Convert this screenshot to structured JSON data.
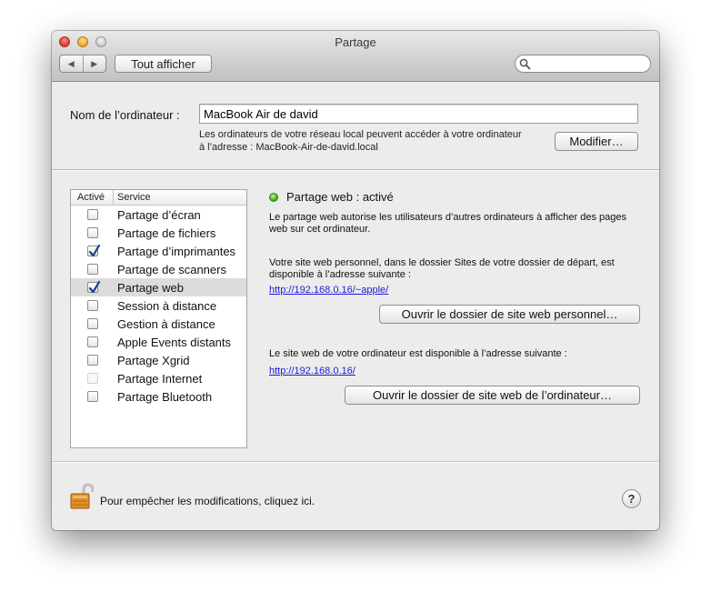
{
  "window": {
    "title": "Partage"
  },
  "toolbar": {
    "back_glyph": "◀",
    "forward_glyph": "▶",
    "show_all_label": "Tout afficher",
    "search_icon": "magnifier-icon",
    "search_value": ""
  },
  "computer": {
    "label": "Nom de l’ordinateur :",
    "name_value": "MacBook Air de david",
    "address_note": "Les ordinateurs de votre réseau local peuvent accéder à votre ordinateur à l’adresse : MacBook-Air-de-david.local",
    "modify_label": "Modifier…"
  },
  "services": {
    "header_active": "Activé",
    "header_service": "Service",
    "items": [
      {
        "label": "Partage d’écran",
        "checked": false,
        "enabled": true,
        "selected": false
      },
      {
        "label": "Partage de fichiers",
        "checked": false,
        "enabled": true,
        "selected": false
      },
      {
        "label": "Partage d’imprimantes",
        "checked": true,
        "enabled": true,
        "selected": false
      },
      {
        "label": "Partage de scanners",
        "checked": false,
        "enabled": true,
        "selected": false
      },
      {
        "label": "Partage web",
        "checked": true,
        "enabled": true,
        "selected": true
      },
      {
        "label": "Session à distance",
        "checked": false,
        "enabled": true,
        "selected": false
      },
      {
        "label": "Gestion à distance",
        "checked": false,
        "enabled": true,
        "selected": false
      },
      {
        "label": "Apple Events distants",
        "checked": false,
        "enabled": true,
        "selected": false
      },
      {
        "label": "Partage Xgrid",
        "checked": false,
        "enabled": true,
        "selected": false
      },
      {
        "label": "Partage Internet",
        "checked": false,
        "enabled": false,
        "selected": false
      },
      {
        "label": "Partage Bluetooth",
        "checked": false,
        "enabled": true,
        "selected": false
      }
    ]
  },
  "detail": {
    "status": "Partage web : activé",
    "status_color": "#3fb41c",
    "description": "Le partage web autorise les utilisateurs d’autres ordinateurs à afficher des pages web sur cet ordinateur.",
    "personal_text": "Votre site web personnel, dans le dossier Sites de votre dossier de départ, est disponible à l’adresse suivante :",
    "personal_url": "http://192.168.0.16/~apple/",
    "open_personal_label": "Ouvrir le dossier de site web personnel…",
    "computer_text": "Le site web de votre ordinateur est disponible à l’adresse suivante :",
    "computer_url": "http://192.168.0.16/",
    "open_computer_label": "Ouvrir le dossier de site web de l’ordinateur…"
  },
  "footer": {
    "lock_icon": "unlocked-padlock-icon",
    "lock_text": "Pour empêcher les modifications, cliquez ici.",
    "help_label": "?"
  }
}
